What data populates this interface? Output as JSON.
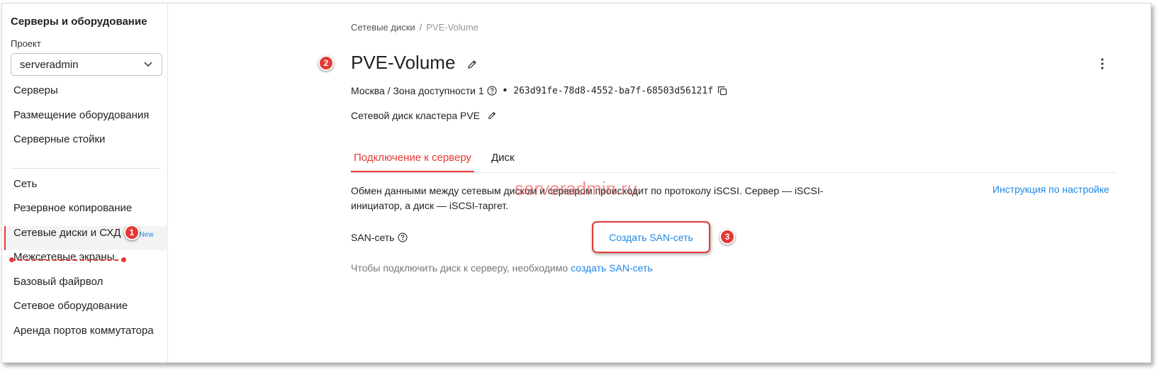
{
  "sidebar": {
    "title": "Серверы и оборудование",
    "project_label": "Проект",
    "project_value": "serveradmin",
    "items": [
      {
        "label": "Серверы"
      },
      {
        "label": "Размещение оборудования"
      },
      {
        "label": "Серверные стойки"
      },
      {
        "label": "Сеть"
      },
      {
        "label": "Резервное копирование"
      },
      {
        "label": "Сетевые диски и СХД",
        "badge": "New",
        "active": true
      },
      {
        "label": "Межсетевые экраны"
      },
      {
        "label": "Базовый файрвол"
      },
      {
        "label": "Сетевое оборудование"
      },
      {
        "label": "Аренда портов коммутатора"
      }
    ]
  },
  "breadcrumb": {
    "parent": "Сетевые диски",
    "separator": "/",
    "current": "PVE-Volume"
  },
  "volume": {
    "title": "PVE-Volume",
    "location": "Москва / Зона доступности 1",
    "bullet": "•",
    "id": "263d91fe-78d8-4552-ba7f-68503d56121f",
    "description": "Сетевой диск кластера PVE"
  },
  "tabs": [
    {
      "label": "Подключение к серверу",
      "active": true
    },
    {
      "label": "Диск",
      "active": false
    }
  ],
  "connection": {
    "info": "Обмен данными между сетевым диском и сервером происходит по протоколу iSCSI. Сервер — iSCSI-инициатор, а диск — iSCSI-таргет.",
    "instructions_link": "Инструкция по настройке",
    "san_label": "SAN-сеть",
    "create_san_button": "Создать SAN-сеть",
    "hint_text": "Чтобы подключить диск к серверу, необходимо",
    "hint_link": "создать SAN-сеть"
  },
  "watermark": "serveradmin.ru",
  "callouts": [
    "1",
    "2",
    "3"
  ],
  "colors": {
    "accent_red": "#e53935",
    "link_blue": "#1e88e5"
  },
  "icons": {
    "select_chevron": "chevron-down-icon",
    "edit": "pencil-icon",
    "help": "help-circle-icon",
    "copy": "copy-icon",
    "more": "kebab-menu-icon"
  }
}
